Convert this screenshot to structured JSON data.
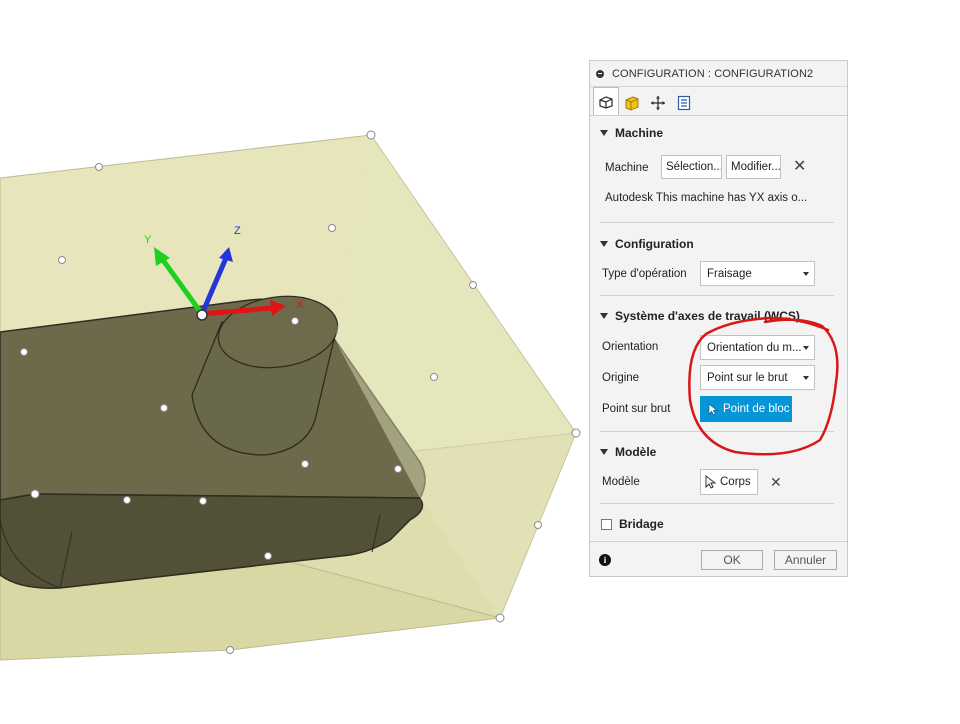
{
  "panel": {
    "title": "CONFIGURATION : CONFIGURATION2",
    "tabs": [
      "setup-tab-icon",
      "stock-tab-icon",
      "post-process-tab-icon",
      "program-tab-icon"
    ],
    "machine": {
      "header": "Machine",
      "label": "Machine",
      "select_button": "Sélection...",
      "edit_button": "Modifier...",
      "description": "Autodesk This machine has YX axis o..."
    },
    "configuration": {
      "header": "Configuration",
      "op_type_label": "Type d'opération",
      "op_type_value": "Fraisage"
    },
    "wcs": {
      "header": "Système d'axes de travail (WCS)",
      "orientation_label": "Orientation",
      "orientation_value": "Orientation du m...",
      "origin_label": "Origine",
      "origin_value": "Point sur le brut",
      "stock_point_label": "Point sur brut",
      "stock_point_button": "Point de bloc"
    },
    "model": {
      "header": "Modèle",
      "label": "Modèle",
      "button": "Corps"
    },
    "fixture": {
      "label": "Bridage",
      "checked": false
    },
    "footer": {
      "ok": "OK",
      "cancel": "Annuler"
    }
  },
  "viewport": {
    "axis_labels": {
      "x": "X",
      "y": "Y",
      "z": "Z"
    }
  },
  "colors": {
    "accent": "#0696d7",
    "annotation": "#d81818",
    "stock": "#e3e2b3",
    "part": "#5f5d3f"
  }
}
